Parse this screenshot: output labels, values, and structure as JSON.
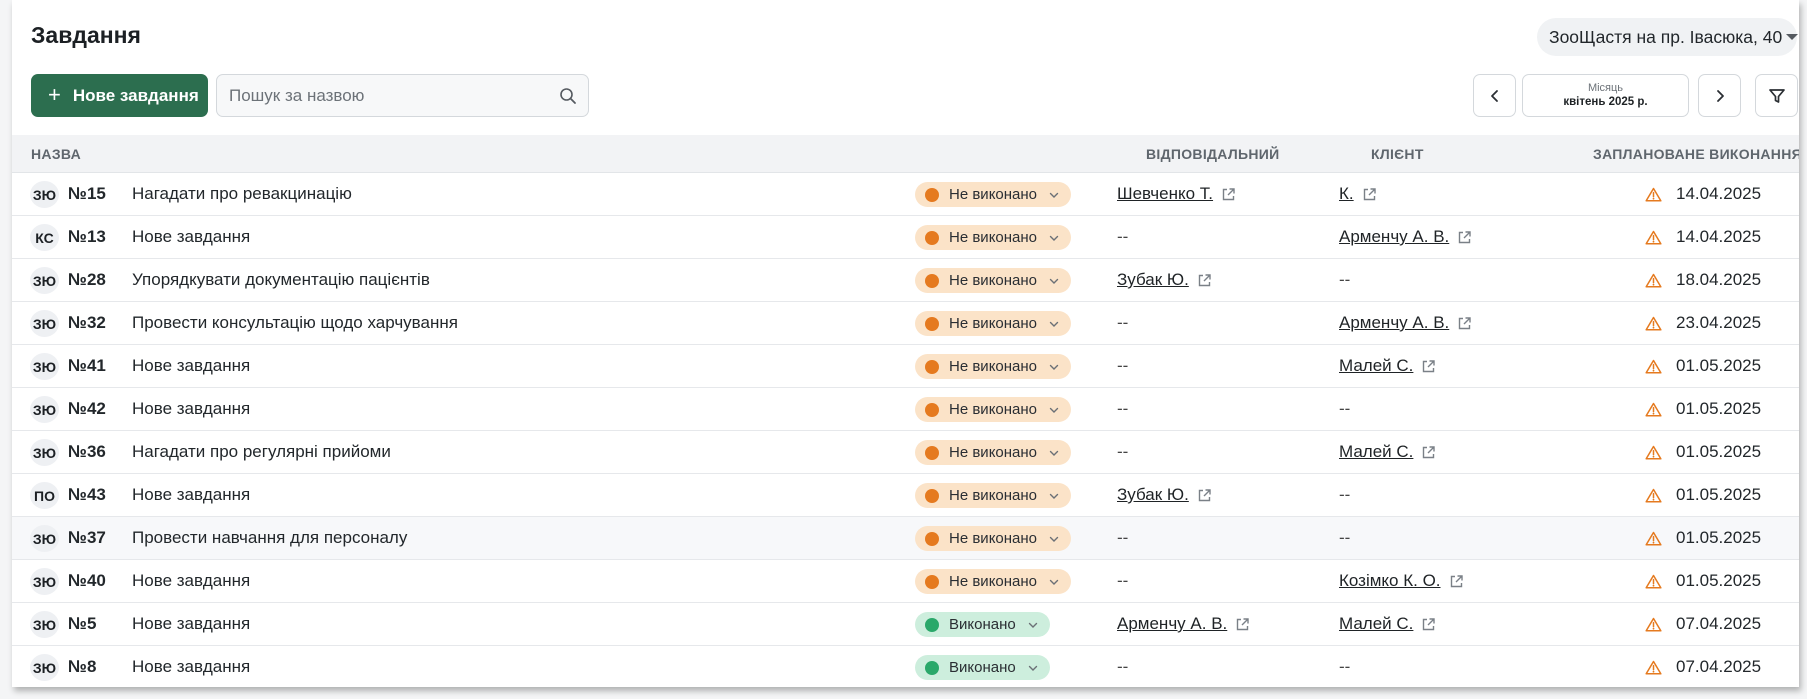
{
  "header": {
    "title": "Завдання",
    "clinic_selector": "ЗооЩастя на пр. Івасюка, 40"
  },
  "toolbar": {
    "new_task_label": "Нове завдання",
    "search_placeholder": "Пошук за назвою",
    "period_label": "Місяць",
    "period_value": "квітень 2025 р."
  },
  "columns": {
    "name": "НАЗВА",
    "responsible": "ВІДПОВІДАЛЬНИЙ",
    "client": "КЛІЄНТ",
    "planned": "ЗАПЛАНОВАНЕ ВИКОНАННЯ"
  },
  "colors": {
    "primary": "#2c6e4f",
    "pending_bg": "#fbe3c8",
    "pending_dot": "#e57a1f",
    "done_bg": "#cdeedd",
    "done_dot": "#2aa86a",
    "warning": "#e57a1f"
  },
  "tasks": [
    {
      "initials": "ЗЮ",
      "number": "№15",
      "title": "Нагадати про ревакцинацію",
      "status": "Не виконано",
      "status_type": "pending",
      "responsible": "Шевченко Т.",
      "client": "К.",
      "date": "14.04.2025"
    },
    {
      "initials": "КС",
      "number": "№13",
      "title": "Нове завдання",
      "status": "Не виконано",
      "status_type": "pending",
      "responsible": "--",
      "client": "Арменчу А. В.",
      "date": "14.04.2025"
    },
    {
      "initials": "ЗЮ",
      "number": "№28",
      "title": "Упорядкувати документацію пацієнтів",
      "status": "Не виконано",
      "status_type": "pending",
      "responsible": "Зубак Ю.",
      "client": "--",
      "date": "18.04.2025"
    },
    {
      "initials": "ЗЮ",
      "number": "№32",
      "title": "Провести консультацію щодо харчування",
      "status": "Не виконано",
      "status_type": "pending",
      "responsible": "--",
      "client": "Арменчу А. В.",
      "date": "23.04.2025"
    },
    {
      "initials": "ЗЮ",
      "number": "№41",
      "title": "Нове завдання",
      "status": "Не виконано",
      "status_type": "pending",
      "responsible": "--",
      "client": "Малей С.",
      "date": "01.05.2025"
    },
    {
      "initials": "ЗЮ",
      "number": "№42",
      "title": "Нове завдання",
      "status": "Не виконано",
      "status_type": "pending",
      "responsible": "--",
      "client": "--",
      "date": "01.05.2025"
    },
    {
      "initials": "ЗЮ",
      "number": "№36",
      "title": "Нагадати про регулярні прийоми",
      "status": "Не виконано",
      "status_type": "pending",
      "responsible": "--",
      "client": "Малей С.",
      "date": "01.05.2025"
    },
    {
      "initials": "ПО",
      "number": "№43",
      "title": "Нове завдання",
      "status": "Не виконано",
      "status_type": "pending",
      "responsible": "Зубак Ю.",
      "client": "--",
      "date": "01.05.2025"
    },
    {
      "initials": "ЗЮ",
      "number": "№37",
      "title": "Провести навчання для персоналу",
      "status": "Не виконано",
      "status_type": "pending",
      "responsible": "--",
      "client": "--",
      "date": "01.05.2025"
    },
    {
      "initials": "ЗЮ",
      "number": "№40",
      "title": "Нове завдання",
      "status": "Не виконано",
      "status_type": "pending",
      "responsible": "--",
      "client": "Козімко К. О.",
      "date": "01.05.2025"
    },
    {
      "initials": "ЗЮ",
      "number": "№5",
      "title": "Нове завдання",
      "status": "Виконано",
      "status_type": "done",
      "responsible": "Арменчу А. В.",
      "client": "Малей С.",
      "date": "07.04.2025"
    },
    {
      "initials": "ЗЮ",
      "number": "№8",
      "title": "Нове завдання",
      "status": "Виконано",
      "status_type": "done",
      "responsible": "--",
      "client": "--",
      "date": "07.04.2025"
    }
  ]
}
